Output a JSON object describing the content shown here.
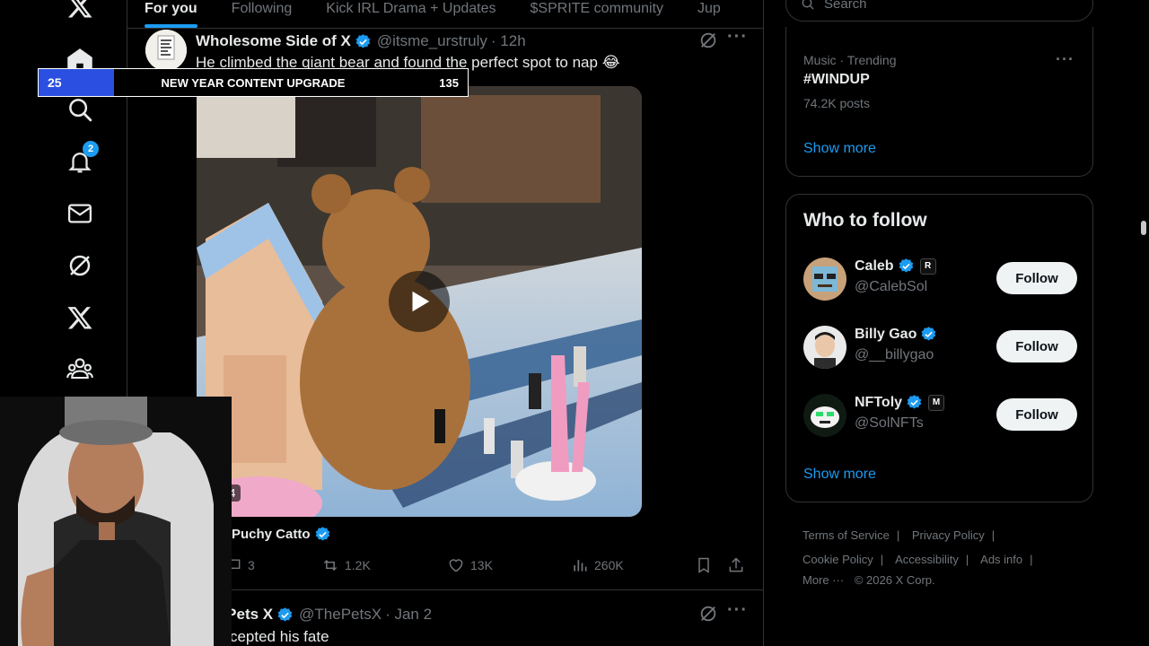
{
  "overlay": {
    "left_value": "25",
    "title": "NEW YEAR CONTENT UPGRADE",
    "right_value": "135",
    "progress_fraction": 0.175,
    "fill_color": "#2b4fe0"
  },
  "nav": {
    "notification_count": "2",
    "icons": [
      "x-logo-icon",
      "home-icon",
      "search-icon",
      "bell-icon",
      "mail-icon",
      "grok-icon",
      "premium-x-icon",
      "communities-icon"
    ]
  },
  "tabs": [
    {
      "label": "For you",
      "active": true
    },
    {
      "label": "Following",
      "active": false
    },
    {
      "label": "Kick IRL Drama + Updates",
      "active": false
    },
    {
      "label": "$SPRITE community",
      "active": false
    },
    {
      "label": "Jup",
      "active": false
    }
  ],
  "post": {
    "author": "Wholesome Side of X",
    "handle": "@itsme_urstruly",
    "time": "· 12h",
    "text": "He climbed the giant bear and found the perfect spot to nap 😂",
    "video_duration": "0:24",
    "quoted_author": "Puchy Catto",
    "replies": "3",
    "reposts": "1.2K",
    "likes": "13K",
    "views": "260K"
  },
  "post2": {
    "author": "e Pets X",
    "handle": "@ThePetsX",
    "time": "· Jan 2",
    "text": "accepted his fate"
  },
  "search": {
    "placeholder": "Search"
  },
  "trend": {
    "meta": "Music · Trending",
    "name": "#WINDUP",
    "posts": "74.2K posts",
    "show_more": "Show more"
  },
  "who_to_follow": {
    "title": "Who to follow",
    "show_more": "Show more",
    "accounts": [
      {
        "name": "Caleb",
        "handle": "@CalebSol",
        "button": "Follow",
        "badge": "R"
      },
      {
        "name": "Billy Gao",
        "handle": "@__billygao",
        "button": "Follow",
        "badge": ""
      },
      {
        "name": "NFToly",
        "handle": "@SolNFTs",
        "button": "Follow",
        "badge": "M"
      }
    ]
  },
  "footer": {
    "terms": "Terms of Service",
    "privacy": "Privacy Policy",
    "cookie": "Cookie Policy",
    "accessibility": "Accessibility",
    "ads": "Ads info",
    "more": "More ···",
    "copyright": "© 2026 X Corp."
  },
  "colors": {
    "accent": "#1d9bf0",
    "background": "#000000",
    "border": "#2f3336",
    "muted_text": "#71767b"
  }
}
